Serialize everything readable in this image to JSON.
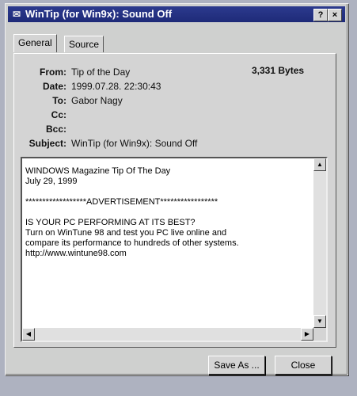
{
  "window": {
    "title": "WinTip (for Win9x): Sound Off",
    "help_btn": "?",
    "close_btn": "×"
  },
  "tabs": [
    {
      "label": "General"
    },
    {
      "label": "Source"
    }
  ],
  "header": {
    "from_label": "From:",
    "from_value": "Tip of the Day",
    "date_label": "Date:",
    "date_value": "1999.07.28. 22:30:43",
    "to_label": "To:",
    "to_value": "Gabor Nagy",
    "cc_label": "Cc:",
    "cc_value": "",
    "bcc_label": "Bcc:",
    "bcc_value": "",
    "subject_label": "Subject:",
    "subject_value": "WinTip (for Win9x): Sound Off",
    "size": "3,331 Bytes"
  },
  "message": {
    "body": "WINDOWS Magazine Tip Of The Day\nJuly 29, 1999\n\n******************ADVERTISEMENT*****************\n\nIS YOUR PC PERFORMING AT ITS BEST?\nTurn on WinTune 98 and test you PC live online and\ncompare its performance to hundreds of other systems.\nhttp://www.wintune98.com"
  },
  "buttons": {
    "save_as": "Save As ...",
    "close": "Close"
  }
}
